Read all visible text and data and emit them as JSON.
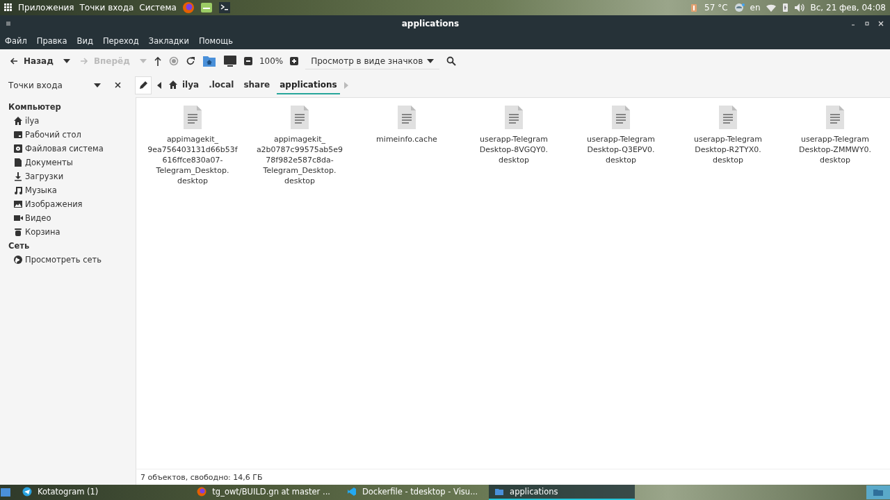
{
  "top_panel": {
    "menus": [
      "Приложения",
      "Точки входа",
      "Система"
    ],
    "temperature": "57 °C",
    "keyboard_layout": "en",
    "clock": "Вс, 21 фев, 04:08"
  },
  "window": {
    "title": "applications"
  },
  "menu_bar": [
    "Файл",
    "Правка",
    "Вид",
    "Переход",
    "Закладки",
    "Помощь"
  ],
  "toolbar": {
    "back": {
      "label": "Назад",
      "disabled": false
    },
    "forward": {
      "label": "Вперёд",
      "disabled": true
    },
    "zoom": "100%",
    "view_mode": "Просмотр в виде значков"
  },
  "sidebar": {
    "header": "Точки входа",
    "sections": [
      {
        "title": "Компьютер",
        "items": [
          {
            "label": "ilya",
            "kind": "home"
          },
          {
            "label": "Рабочий стол",
            "kind": "desktop"
          },
          {
            "label": "Файловая система",
            "kind": "drive"
          },
          {
            "label": "Документы",
            "kind": "document"
          },
          {
            "label": "Загрузки",
            "kind": "download"
          },
          {
            "label": "Музыка",
            "kind": "music"
          },
          {
            "label": "Изображения",
            "kind": "pictures"
          },
          {
            "label": "Видео",
            "kind": "video"
          },
          {
            "label": "Корзина",
            "kind": "trash"
          }
        ]
      },
      {
        "title": "Сеть",
        "items": [
          {
            "label": "Просмотреть сеть",
            "kind": "network"
          }
        ]
      }
    ]
  },
  "breadcrumb": [
    {
      "label": "ilya",
      "kind": "home",
      "selected": false
    },
    {
      "label": ".local",
      "kind": "folder",
      "selected": false
    },
    {
      "label": "share",
      "kind": "folder",
      "selected": false
    },
    {
      "label": "applications",
      "kind": "folder",
      "selected": true
    }
  ],
  "files": [
    {
      "name": "appimagekit_\n9ea756403131d66b53f\n616ffce830a07-\nTelegram_Desktop.\ndesktop"
    },
    {
      "name": "appimagekit_\na2b0787c99575ab5e9\n78f982e587c8da-\nTelegram_Desktop.\ndesktop"
    },
    {
      "name": "mimeinfo.cache"
    },
    {
      "name": "userapp-Telegram\nDesktop-8VGQY0.\ndesktop"
    },
    {
      "name": "userapp-Telegram\nDesktop-Q3EPV0.\ndesktop"
    },
    {
      "name": "userapp-Telegram\nDesktop-R2TYX0.\ndesktop"
    },
    {
      "name": "userapp-Telegram\nDesktop-ZMMWY0.\ndesktop"
    }
  ],
  "status_bar": "7 объектов, свободно: 14,6 ГБ",
  "taskbar": [
    {
      "label": "Kotatogram (1)",
      "kind": "telegram",
      "selected": false
    },
    {
      "label": "tg_owt/BUILD.gn at master ...",
      "kind": "firefox",
      "selected": false
    },
    {
      "label": "Dockerfile - tdesktop - Visu...",
      "kind": "vscode",
      "selected": false
    },
    {
      "label": "applications",
      "kind": "folder",
      "selected": true
    }
  ]
}
